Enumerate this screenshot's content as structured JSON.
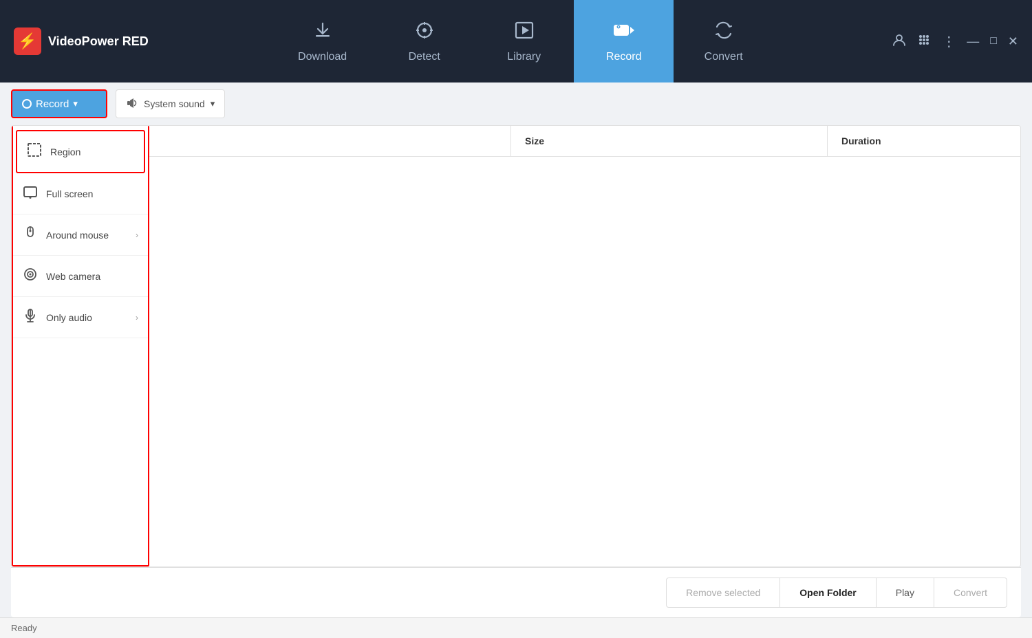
{
  "app": {
    "name": "VideoPower RED",
    "logo_char": "⚡"
  },
  "titlebar": {
    "controls": {
      "user_icon": "👤",
      "grid_icon": "✦",
      "menu_icon": "⋮",
      "minimize": "—",
      "maximize": "□",
      "close": "✕"
    }
  },
  "nav": {
    "tabs": [
      {
        "id": "download",
        "label": "Download",
        "icon": "⬇"
      },
      {
        "id": "detect",
        "label": "Detect",
        "icon": "◎"
      },
      {
        "id": "library",
        "label": "Library",
        "icon": "▶"
      },
      {
        "id": "record",
        "label": "Record",
        "icon": "🎥",
        "active": true
      },
      {
        "id": "convert",
        "label": "Convert",
        "icon": "🔄"
      }
    ]
  },
  "toolbar": {
    "record_btn_label": "Record",
    "record_dropdown_icon": "▾",
    "sound_btn_label": "System sound",
    "sound_icon": "🔊",
    "sound_dropdown": "▾"
  },
  "sidebar": {
    "items": [
      {
        "id": "region",
        "label": "Region",
        "icon": "region",
        "has_arrow": false,
        "highlighted": true
      },
      {
        "id": "fullscreen",
        "label": "Full screen",
        "icon": "monitor",
        "has_arrow": false
      },
      {
        "id": "around-mouse",
        "label": "Around mouse",
        "icon": "mouse",
        "has_arrow": true
      },
      {
        "id": "web-camera",
        "label": "Web camera",
        "icon": "webcam",
        "has_arrow": false
      },
      {
        "id": "only-audio",
        "label": "Only audio",
        "icon": "audio",
        "has_arrow": true
      }
    ]
  },
  "file_list": {
    "columns": [
      {
        "id": "name",
        "label": ""
      },
      {
        "id": "size",
        "label": "Size"
      },
      {
        "id": "duration",
        "label": "Duration"
      }
    ]
  },
  "bottom_buttons": [
    {
      "id": "remove-selected",
      "label": "Remove selected"
    },
    {
      "id": "open-folder",
      "label": "Open Folder"
    },
    {
      "id": "play",
      "label": "Play"
    },
    {
      "id": "convert",
      "label": "Convert"
    }
  ],
  "status": {
    "text": "Ready"
  }
}
